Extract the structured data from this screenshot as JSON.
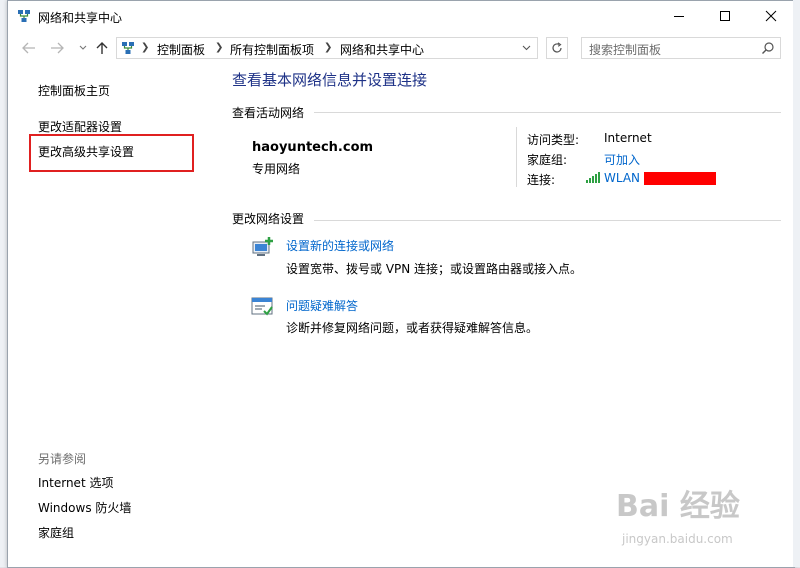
{
  "window": {
    "title": "网络和共享中心"
  },
  "address_bar": {
    "crumbs": [
      "控制面板",
      "所有控制面板项",
      "网络和共享中心"
    ]
  },
  "search": {
    "placeholder": "搜索控制面板"
  },
  "sidebar": {
    "items": [
      {
        "label": "控制面板主页"
      },
      {
        "label": "更改适配器设置"
      },
      {
        "label": "更改高级共享设置"
      }
    ],
    "see_also_label": "另请参阅",
    "see_also": [
      {
        "label": "Internet 选项"
      },
      {
        "label": "Windows 防火墙"
      },
      {
        "label": "家庭组"
      }
    ]
  },
  "main": {
    "heading": "查看基本网络信息并设置连接",
    "active_networks_label": "查看活动网络",
    "network": {
      "name": "haoyuntech.com",
      "type": "专用网络",
      "access_type_label": "访问类型:",
      "access_type_value": "Internet",
      "homegroup_label": "家庭组:",
      "homegroup_value": "可加入",
      "connection_label": "连接:",
      "connection_value": "WLAN"
    },
    "change_settings_label": "更改网络设置",
    "tasks": [
      {
        "title": "设置新的连接或网络",
        "desc": "设置宽带、拨号或 VPN 连接；或设置路由器或接入点。",
        "icon": "new-connection-icon"
      },
      {
        "title": "问题疑难解答",
        "desc": "诊断并修复网络问题，或者获得疑难解答信息。",
        "icon": "troubleshoot-icon"
      }
    ]
  },
  "watermark": {
    "line1": "Bai 经验",
    "line2": "jingyan.baidu.com"
  },
  "colors": {
    "heading": "#1e3287",
    "link": "#0066cc",
    "highlight": "#e02020"
  }
}
